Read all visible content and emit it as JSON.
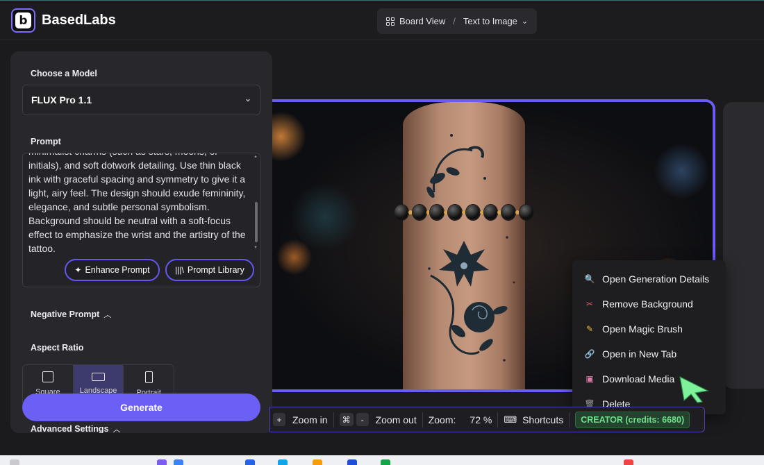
{
  "app": {
    "brand": "BasedLabs",
    "logo_letter": "b"
  },
  "breadcrumb": {
    "view": "Board View",
    "separator": "/",
    "mode": "Text to Image"
  },
  "panel": {
    "model_label": "Choose a Model",
    "model_value": "FLUX Pro 1.1",
    "prompt_label": "Prompt",
    "prompt_text": "minimalist charms (such as stars, moons, or initials), and soft dotwork detailing. Use thin black ink with graceful spacing and symmetry to give it a light, airy feel. The design should exude femininity, elegance, and subtle personal symbolism. Background should be neutral with a soft-focus effect to emphasize the wrist and the artistry of the tattoo.",
    "enhance_label": "Enhance Prompt",
    "library_label": "Prompt Library",
    "negative_label": "Negative Prompt",
    "aspect_label": "Aspect Ratio",
    "ratios": [
      {
        "label": "Square",
        "selected": false
      },
      {
        "label": "Landscape",
        "selected": true
      },
      {
        "label": "Portrait",
        "selected": false
      }
    ],
    "generate_label": "Generate",
    "advanced_label": "Advanced Settings"
  },
  "context_menu": [
    {
      "label": "Open Generation Details",
      "icon": "magnifier-icon"
    },
    {
      "label": "Remove Background",
      "icon": "scissors-icon"
    },
    {
      "label": "Open Magic Brush",
      "icon": "pencil-icon"
    },
    {
      "label": "Open in New Tab",
      "icon": "link-icon"
    },
    {
      "label": "Download Media",
      "icon": "floppy-disk-icon"
    },
    {
      "label": "Delete",
      "icon": "trash-icon"
    }
  ],
  "toolbar": {
    "zoom_in_key": "+",
    "zoom_in_label": "Zoom in",
    "cmd_key": "⌘",
    "minus_key": "-",
    "zoom_out_label": "Zoom out",
    "zoom_label": "Zoom:",
    "zoom_value": "72 %",
    "shortcuts_label": "Shortcuts",
    "credits": "CREATOR (credits: 6680)"
  },
  "colors": {
    "accent": "#6b5ff5",
    "credit_green": "#6ee08a",
    "background": "#1b1b1e"
  }
}
